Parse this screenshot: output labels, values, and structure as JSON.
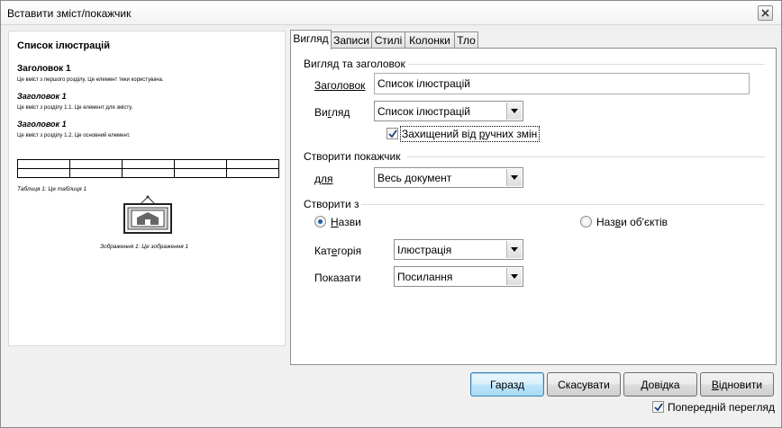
{
  "window": {
    "title": "Вставити зміст/покажчик"
  },
  "preview": {
    "title": "Список ілюстрацій",
    "heading1": "Заголовок 1",
    "heading1_text": "Це вміст з першого розділу. Це елемент теки користувача.",
    "heading1_1": "Заголовок 1",
    "heading1_1_text": "Це вміст з розділу 1.1. Це елемент для змісту.",
    "heading1_2": "Заголовок 1",
    "heading1_2_text": "Це вміст з розділу 1.2. Це основний елемент.",
    "table_caption": "Таблиця 1: Це таблиця 1",
    "image_caption": "Зображення 1: Це зображення 1"
  },
  "tabs": [
    {
      "label": "Вигляд",
      "active": true
    },
    {
      "label": "Записи",
      "active": false
    },
    {
      "label": "Стилі",
      "active": false
    },
    {
      "label": "Колонки",
      "active": false
    },
    {
      "label": "Тло",
      "active": false
    }
  ],
  "type_section": {
    "label": "Вигляд та заголовок",
    "title_label": "Заголовок",
    "title_value": "Список ілюстрацій",
    "type_label": "Вигляд",
    "type_value": "Список ілюстрацій",
    "protected_label": "Захищений від ручних змін",
    "protected_checked": true
  },
  "index_section": {
    "label": "Створити покажчик",
    "for_label": "для",
    "for_value": "Весь документ"
  },
  "create_from_section": {
    "label": "Створити з",
    "captions_label": "Назви",
    "captions_checked": true,
    "object_names_label": "Назви об'єктів",
    "object_names_checked": false,
    "category_label": "Категорія",
    "category_value": "Ілюстрація",
    "display_label": "Показати",
    "display_value": "Посилання"
  },
  "buttons": {
    "ok": "Гаразд",
    "cancel": "Скасувати",
    "help": "Довідка",
    "reset": "Відновити"
  },
  "preview_checkbox": {
    "label": "Попередній перегляд",
    "checked": true
  }
}
